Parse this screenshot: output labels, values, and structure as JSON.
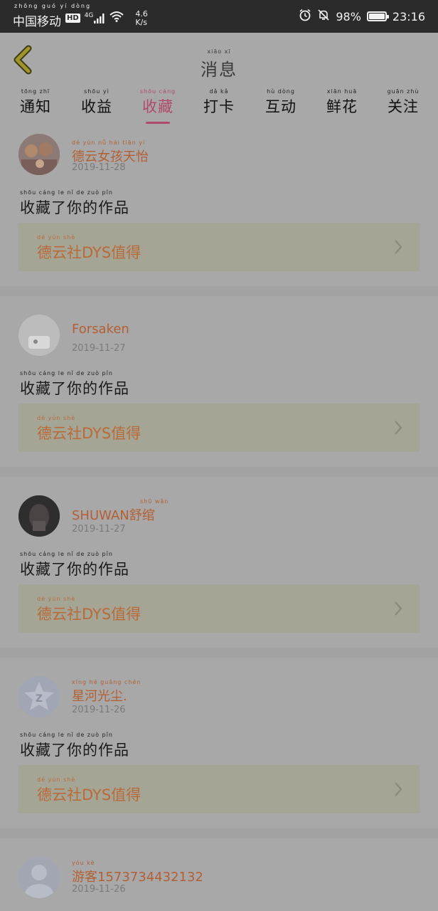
{
  "status_bar": {
    "carrier_pinyin": "zhōng guó yí dòng",
    "carrier": "中国移动",
    "hd": "HD",
    "network": "4G",
    "speed_value": "4.6",
    "speed_unit": "K/s",
    "battery": "98%",
    "time": "23:16"
  },
  "header": {
    "title_pinyin": "xiāo xī",
    "title": "消息"
  },
  "tabs": [
    {
      "pinyin": "tōng zhī",
      "label": "通知",
      "active": false
    },
    {
      "pinyin": "shōu yì",
      "label": "收益",
      "active": false
    },
    {
      "pinyin": "shōu cáng",
      "label": "收藏",
      "active": true
    },
    {
      "pinyin": "dǎ kǎ",
      "label": "打卡",
      "active": false
    },
    {
      "pinyin": "hù dòng",
      "label": "互动",
      "active": false
    },
    {
      "pinyin": "xiān huā",
      "label": "鲜花",
      "active": false
    },
    {
      "pinyin": "guān zhù",
      "label": "关注",
      "active": false
    }
  ],
  "items": [
    {
      "name_pinyin": "dé yún nǚ hái tiān yí",
      "name": "德云女孩天怡",
      "date": "2019-11-28",
      "action_pinyin": "shōu cáng le nǐ de zuò pǐn",
      "action": "收藏了你的作品",
      "work_pinyin": "dé yún shè",
      "work": "德云社DYS值得"
    },
    {
      "name_pinyin": "",
      "name": "Forsaken",
      "date": "2019-11-27",
      "action_pinyin": "shōu cáng le nǐ de zuò pǐn",
      "action": "收藏了你的作品",
      "work_pinyin": "dé yún shè",
      "work": "德云社DYS值得"
    },
    {
      "name_pinyin": "shū wǎn",
      "name": "SHUWAN舒绾",
      "date": "2019-11-27",
      "action_pinyin": "shōu cáng le nǐ de zuò pǐn",
      "action": "收藏了你的作品",
      "work_pinyin": "dé yún shè",
      "work": "德云社DYS值得"
    },
    {
      "name_pinyin": "xīng hé guāng chén",
      "name": "星河光尘.",
      "date": "2019-11-26",
      "action_pinyin": "shōu cáng le nǐ de zuò pǐn",
      "action": "收藏了你的作品",
      "work_pinyin": "dé yún shè",
      "work": "德云社DYS值得"
    },
    {
      "name_pinyin": "yóu kè",
      "name": "游客1573734432132",
      "date": "2019-11-26"
    }
  ]
}
